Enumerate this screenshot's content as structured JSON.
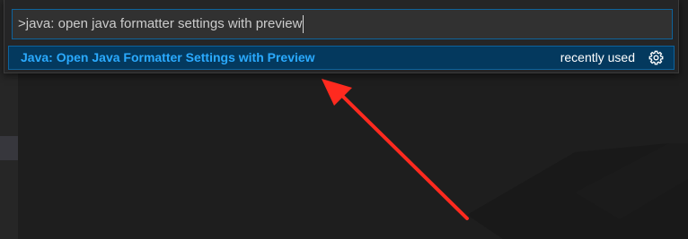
{
  "command_palette": {
    "query": ">java: open java formatter settings with preview",
    "results": [
      {
        "label": "Java: Open Java Formatter Settings with Preview",
        "detail": "recently used",
        "action_icon": "gear-icon"
      }
    ]
  },
  "colors": {
    "selection_background": "#04395e",
    "highlight_label": "#2aaaff",
    "focus_border": "#0e639c",
    "annotation_arrow": "#ff2a1f"
  }
}
